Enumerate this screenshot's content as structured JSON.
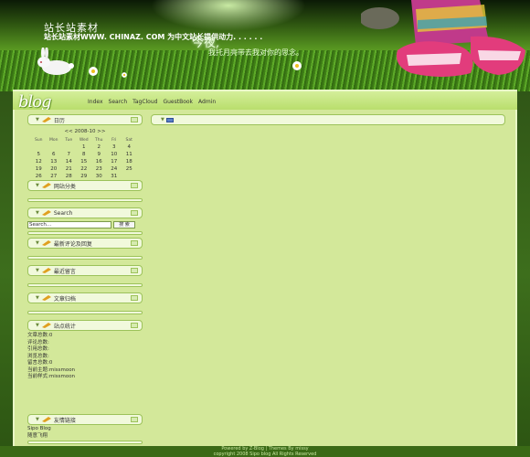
{
  "header": {
    "site_title": "站长站素材",
    "site_subtitle": "站长站素材WWW. CHINAZ. COM 为中文站长提供动力. . . . . .",
    "slogan_main": "今夜,",
    "slogan_sub": "我托月亮带去我对你的思念。"
  },
  "nav": {
    "logo": "blog",
    "items": [
      "Index",
      "Search",
      "TagCloud",
      "GuestBook",
      "Admin"
    ]
  },
  "sidebar": {
    "calendar": {
      "title": "日历",
      "month_label": "<< 2008-10 >>",
      "weekdays": [
        "Sun",
        "Mon",
        "Tue",
        "Wed",
        "Thu",
        "Fri",
        "Sat"
      ],
      "weeks": [
        [
          "",
          "",
          "",
          "1",
          "2",
          "3",
          "4"
        ],
        [
          "5",
          "6",
          "7",
          "8",
          "9",
          "10",
          "11"
        ],
        [
          "12",
          "13",
          "14",
          "15",
          "16",
          "17",
          "18"
        ],
        [
          "19",
          "20",
          "21",
          "22",
          "23",
          "24",
          "25"
        ],
        [
          "26",
          "27",
          "28",
          "29",
          "30",
          "31",
          ""
        ]
      ]
    },
    "categories": {
      "title": "网站分类"
    },
    "search": {
      "title": "Search",
      "value": "Search...",
      "button": "搜 索"
    },
    "comments": {
      "title": "最新评论及回复"
    },
    "guestbook": {
      "title": "最近留言"
    },
    "archives": {
      "title": "文章归档"
    },
    "stats": {
      "title": "站点统计",
      "lines": [
        "文章总数:0",
        "评论总数:",
        "引用总数:",
        "浏览总数:",
        "留言总数:0",
        "当前主题:missmoon",
        "当前样式:missmoon"
      ]
    },
    "links": {
      "title": "友情链接",
      "items": [
        "Sipo Blog",
        "随意飞翔"
      ]
    }
  },
  "main": {
    "box_label": ""
  },
  "footer": {
    "line1": "Powered by Z-Blog | Themes By missy",
    "line2": "copyright 2008 Sipo blog All Rights Reserved"
  },
  "colors": {
    "content_bg": "#d3e89a",
    "box_bg": "#f1f9dc",
    "box_border": "#9cc25a"
  }
}
